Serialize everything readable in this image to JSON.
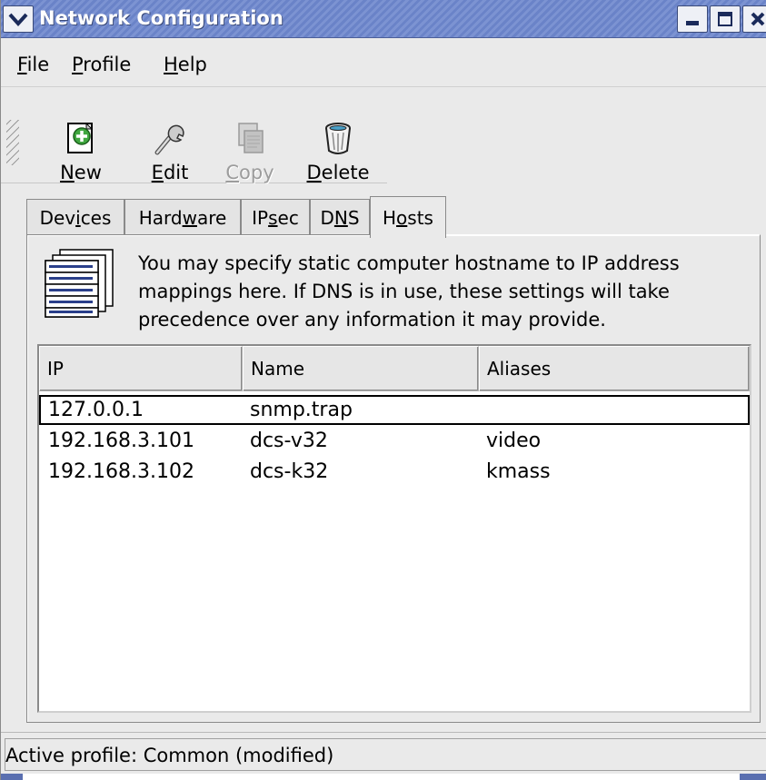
{
  "window": {
    "title": "Network Configuration"
  },
  "menubar": {
    "items": [
      {
        "label": "File",
        "mnemonic": "F",
        "rest": "ile"
      },
      {
        "label": "Profile",
        "mnemonic": "P",
        "rest": "rofile"
      },
      {
        "label": "Help",
        "mnemonic": "H",
        "rest": "elp"
      }
    ]
  },
  "toolbar": {
    "new": {
      "pre": "",
      "mnemonic": "N",
      "rest": "ew",
      "icon": "new-icon"
    },
    "edit": {
      "pre": "",
      "mnemonic": "E",
      "rest": "dit",
      "icon": "wrench-icon"
    },
    "copy": {
      "pre": "",
      "mnemonic": "C",
      "rest": "opy",
      "icon": "copy-icon",
      "disabled": true
    },
    "delete": {
      "pre": "",
      "mnemonic": "D",
      "rest": "elete",
      "icon": "trash-icon"
    }
  },
  "tabs": [
    {
      "pre": "Dev",
      "mnemonic": "i",
      "rest": "ces"
    },
    {
      "pre": "Hard",
      "mnemonic": "w",
      "rest": "are"
    },
    {
      "pre": "IP",
      "mnemonic": "s",
      "rest": "ec"
    },
    {
      "pre": "D",
      "mnemonic": "N",
      "rest": "S"
    },
    {
      "pre": "H",
      "mnemonic": "o",
      "rest": "sts",
      "active": true
    }
  ],
  "hosts": {
    "description_lines": [
      "You may specify static computer hostname to IP address",
      "mappings here.  If DNS is in use, these settings will take",
      "precedence over any information it may provide."
    ],
    "columns": [
      "IP",
      "Name",
      "Aliases"
    ],
    "rows": [
      {
        "ip": "127.0.0.1",
        "name": "snmp.trap",
        "aliases": "",
        "selected": true
      },
      {
        "ip": "192.168.3.101",
        "name": "dcs-v32",
        "aliases": "video"
      },
      {
        "ip": "192.168.3.102",
        "name": "dcs-k32",
        "aliases": "kmass"
      }
    ]
  },
  "status": {
    "text": "Active profile: Common (modified)"
  },
  "colors": {
    "titlebar": "#6a83c8",
    "window_bg": "#eaeaea",
    "list_bg": "#ffffff"
  }
}
